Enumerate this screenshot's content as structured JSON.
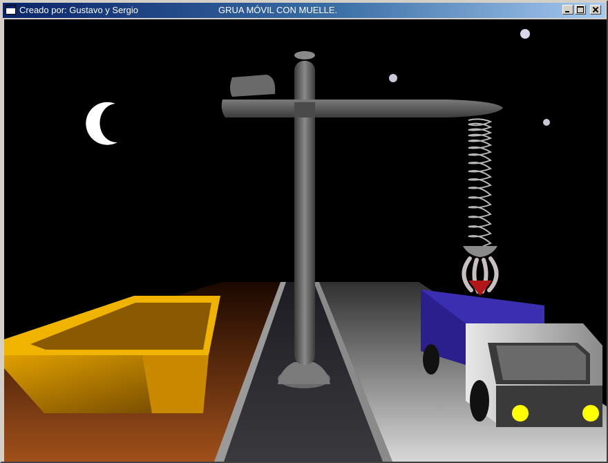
{
  "window": {
    "title_left": "Creado por: Gustavo y Sergio",
    "title_center": "GRUA MÓVIL CON MUELLE."
  },
  "controls": {
    "minimize": "minimize-icon",
    "maximize": "maximize-icon",
    "close": "close-icon"
  },
  "scene": {
    "background": "#000000",
    "colors": {
      "moon": "#ffffff",
      "crane": "#5a5a5a",
      "container": "#c98a00",
      "truck_cargo": "#2a1f8c",
      "truck_cab": "#c8c8c8",
      "headlights": "#ffff00",
      "road": "#2c2c30",
      "sidewalk": "#c8c8c8",
      "ground_left": "#6a2a00"
    }
  }
}
